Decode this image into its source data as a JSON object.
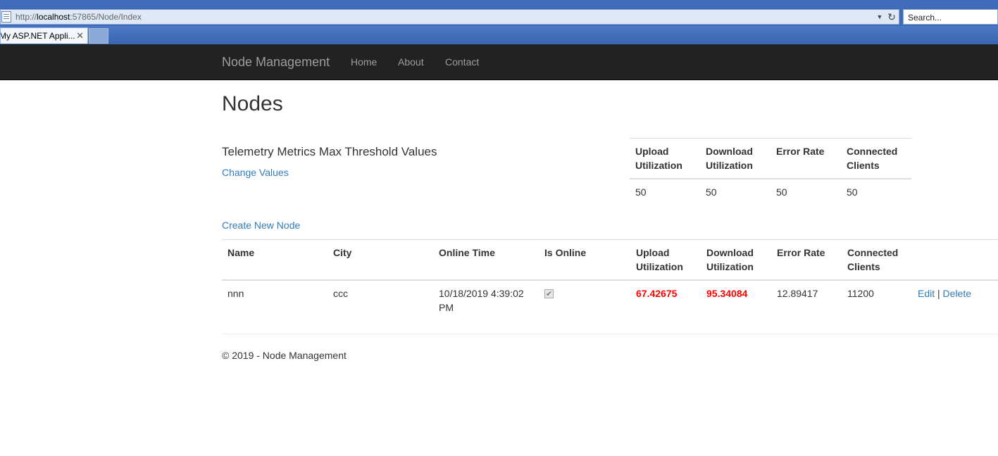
{
  "browser": {
    "url_prefix": "http://",
    "url_host": "localhost",
    "url_rest": ":57865/Node/Index",
    "search_placeholder": "Search...",
    "tab_title": "My ASP.NET Appli...",
    "tab_close": "✕"
  },
  "navbar": {
    "brand": "Node Management",
    "links": [
      "Home",
      "About",
      "Contact"
    ]
  },
  "page": {
    "title": "Nodes",
    "threshold_heading": "Telemetry Metrics Max Threshold Values",
    "change_values_link": "Change Values",
    "create_node_link": "Create New Node"
  },
  "threshold_table": {
    "headers": [
      [
        "Upload",
        "Utilization"
      ],
      [
        "Download",
        "Utilization"
      ],
      [
        "Error Rate",
        ""
      ],
      [
        "Connected",
        "Clients"
      ]
    ],
    "values": [
      "50",
      "50",
      "50",
      "50"
    ]
  },
  "nodes_table": {
    "headers": {
      "name": "Name",
      "city": "City",
      "online_time": "Online Time",
      "is_online": "Is Online",
      "upload": [
        "Upload",
        "Utilization"
      ],
      "download": [
        "Download",
        "Utilization"
      ],
      "error_rate": "Error Rate",
      "connected": [
        "Connected",
        "Clients"
      ]
    },
    "rows": [
      {
        "name": "nnn",
        "city": "ccc",
        "online_time": [
          "10/18/2019 4:39:02",
          "PM"
        ],
        "is_online": true,
        "upload": "67.42675",
        "download": "95.34084",
        "error_rate": "12.89417",
        "connected": "11200",
        "edit": "Edit",
        "separator": "|",
        "delete": "Delete"
      }
    ]
  },
  "footer": {
    "text": "© 2019 - Node Management"
  },
  "colors": {
    "navbar_bg": "#222222",
    "link": "#337ab7",
    "exceeded_value": "#ff0000"
  }
}
